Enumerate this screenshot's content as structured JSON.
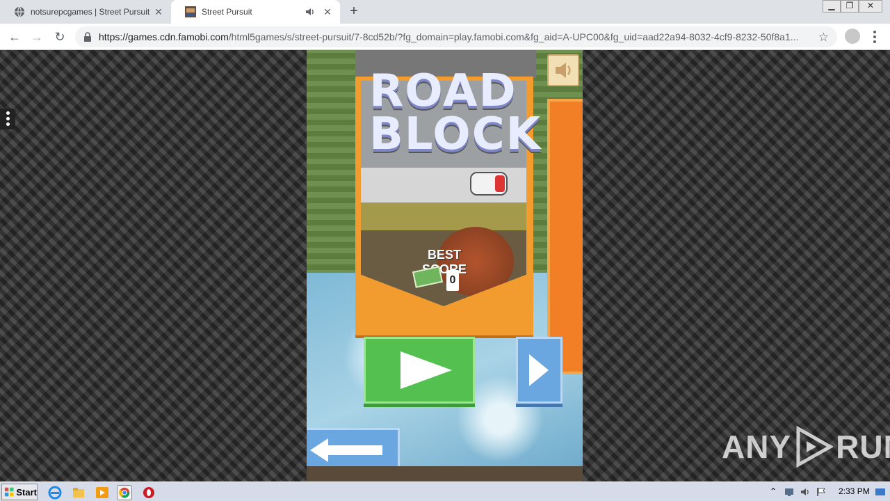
{
  "browser": {
    "tabs": [
      {
        "title": "notsurepcgames | Street Pursuit",
        "active": false
      },
      {
        "title": "Street Pursuit",
        "active": true
      }
    ],
    "url_host": "https://games.cdn.famobi.com",
    "url_path": "/html5games/s/street-pursuit/7-8cd52b/?fg_domain=play.famobi.com&fg_aid=A-UPC00&fg_uid=aad22a94-8032-4cf9-8232-50f8a1..."
  },
  "game": {
    "logo_line1": "ROAD",
    "logo_line2": "BLOCK",
    "best_score_label": "BEST SCORE",
    "best_score_value": "0"
  },
  "watermark": {
    "left": "ANY",
    "right": "RUN"
  },
  "taskbar": {
    "start_label": "Start",
    "clock": "2:33 PM"
  }
}
